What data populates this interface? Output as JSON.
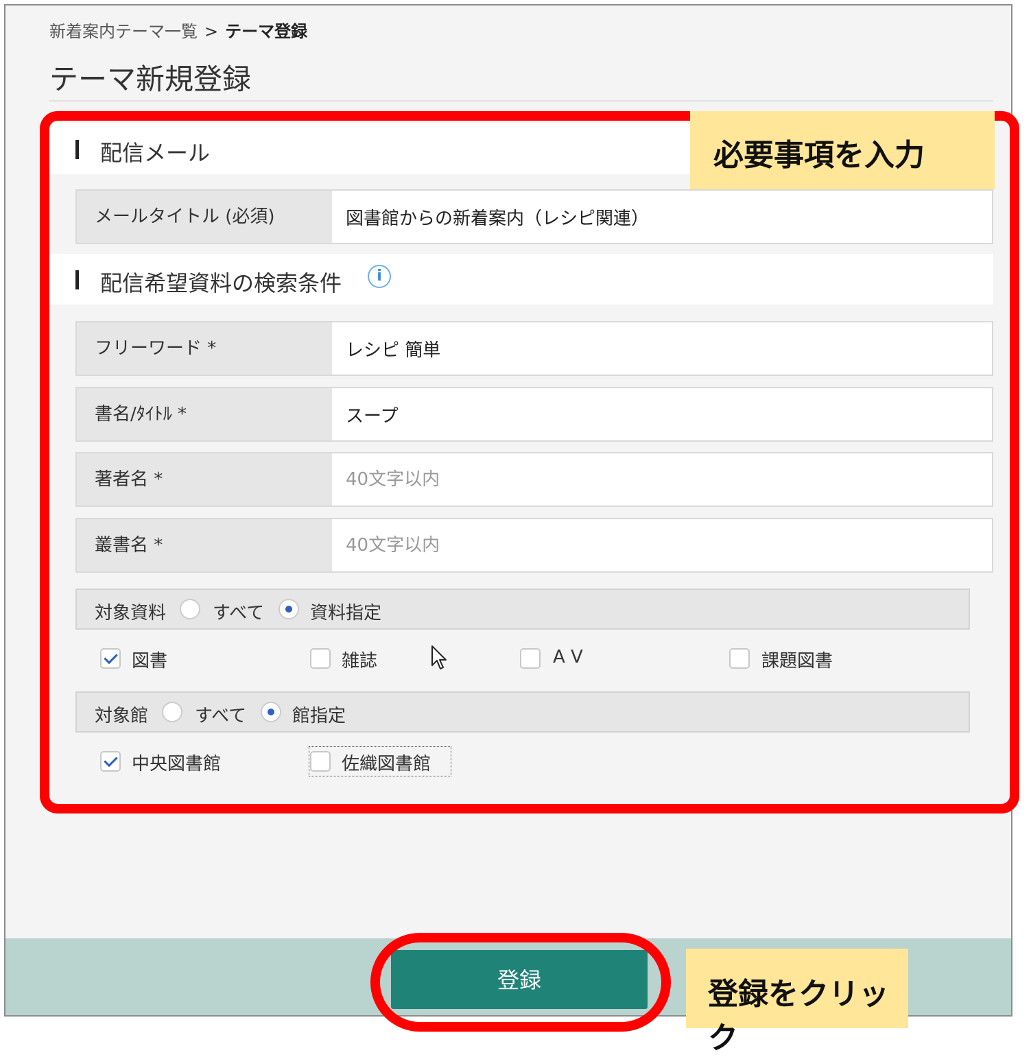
{
  "breadcrumb": {
    "parent": "新着案内テーマ一覧",
    "separator": ">",
    "current": "テーマ登録"
  },
  "page_title": "テーマ新規登録",
  "sections": {
    "mail": {
      "heading": "配信メール"
    },
    "search": {
      "heading": "配信希望資料の検索条件",
      "info_icon": "info-icon"
    }
  },
  "fields": {
    "mail_title": {
      "label": "メールタイトル (必須)",
      "value": "図書館からの新着案内（レシピ関連）"
    },
    "free_word": {
      "label": "フリーワード *",
      "value": "レシピ 簡単"
    },
    "book_title": {
      "label": "書名/ﾀｲﾄﾙ *",
      "value": "スープ"
    },
    "author": {
      "label": "著者名 *",
      "value": "",
      "placeholder": "40文字以内"
    },
    "series": {
      "label": "叢書名 *",
      "value": "",
      "placeholder": "40文字以内"
    }
  },
  "target_material": {
    "label": "対象資料",
    "options": [
      {
        "text": "すべて",
        "selected": false
      },
      {
        "text": "資料指定",
        "selected": true
      }
    ],
    "checkboxes": [
      {
        "text": "図書",
        "checked": true
      },
      {
        "text": "雑誌",
        "checked": false
      },
      {
        "text": "A V",
        "checked": false
      },
      {
        "text": "課題図書",
        "checked": false
      }
    ]
  },
  "target_library": {
    "label": "対象館",
    "options": [
      {
        "text": "すべて",
        "selected": false
      },
      {
        "text": "館指定",
        "selected": true
      }
    ],
    "checkboxes": [
      {
        "text": "中央図書館",
        "checked": true
      },
      {
        "text": "佐織図書館",
        "checked": false
      }
    ]
  },
  "submit_label": "登録",
  "annotations": {
    "enter_required": "必要事項を入力",
    "click_register": "登録をクリック"
  },
  "colors": {
    "accent_red": "#ff0000",
    "note_yellow": "#ffe699",
    "button_teal": "#1f8378",
    "footer_bg": "#b9d3cf",
    "radio_blue": "#2f5ec4"
  }
}
